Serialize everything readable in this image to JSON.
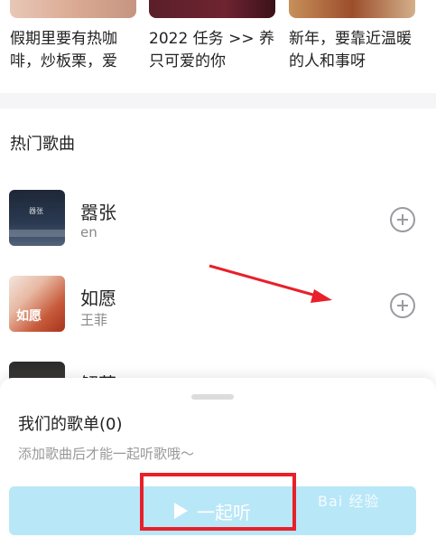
{
  "playlists": [
    {
      "title": "假期里要有热咖啡，炒板栗，爱"
    },
    {
      "title": "2022 任务 >> 养只可爱的你"
    },
    {
      "title": "新年，要靠近温暖的人和事呀"
    }
  ],
  "hot_songs": {
    "section_title": "热门歌曲",
    "songs": [
      {
        "name": "嚣张",
        "artist": "en"
      },
      {
        "name": "如愿",
        "artist": "王菲"
      },
      {
        "name": "解药",
        "artist": ""
      }
    ]
  },
  "sheet": {
    "title": "我们的歌单(0)",
    "hint": "添加歌曲后才能一起听歌哦～",
    "listen_label": "一起听",
    "button_color": "#b8e7f8"
  },
  "annotation": {
    "color": "#e8202a"
  },
  "watermark": "Bai 经验"
}
